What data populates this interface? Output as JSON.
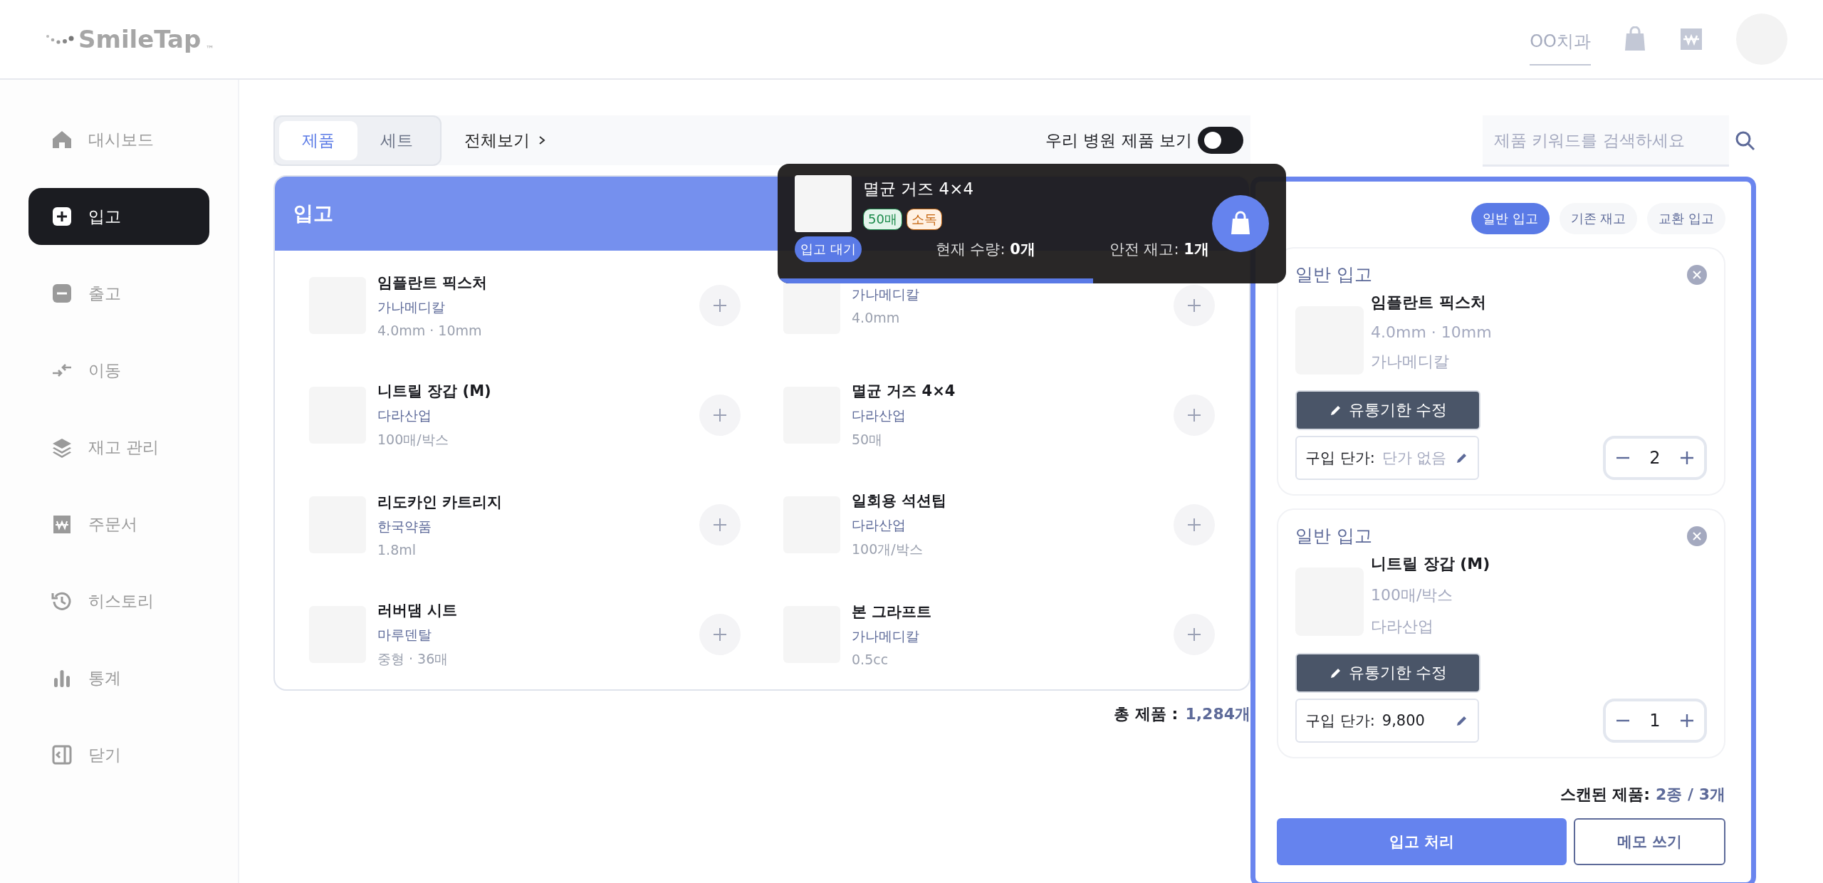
{
  "header": {
    "logo": "SmileTap",
    "trademark": "™",
    "clinic": "OO치과"
  },
  "sidebar": {
    "items": [
      {
        "label": "대시보드",
        "kind": "home",
        "selected": false
      },
      {
        "label": "입고",
        "kind": "plus",
        "selected": true
      },
      {
        "label": "출고",
        "kind": "minus",
        "selected": false
      },
      {
        "label": "이동",
        "kind": "move",
        "selected": false
      },
      {
        "label": "재고 관리",
        "kind": "layers",
        "selected": false
      },
      {
        "label": "주문서",
        "kind": "order",
        "selected": false
      },
      {
        "label": "히스토리",
        "kind": "history",
        "selected": false
      },
      {
        "label": "통계",
        "kind": "stats",
        "selected": false
      },
      {
        "label": "닫기",
        "kind": "collapse",
        "selected": false
      }
    ]
  },
  "toolbar": {
    "tabs": [
      {
        "label": "제품",
        "selected": true
      },
      {
        "label": "세트",
        "selected": false
      }
    ],
    "view_all": "전체보기",
    "toggle": {
      "label": "우리 병원 제품 보기",
      "on": false
    },
    "search": {
      "placeholder": "제품 키워드를 검색하세요"
    }
  },
  "receiving": {
    "title": "입고",
    "products": [
      {
        "name": "임플란트 픽스처",
        "maker": "가나메디칼",
        "spec": "4.0mm · 10mm"
      },
      {
        "maker": "가나메디칼",
        "spec": "4.0mm"
      },
      {
        "name": "니트릴 장갑 (M)",
        "maker": "다라산업",
        "spec": "100매/박스"
      },
      {
        "name": "멸균 거즈 4×4",
        "maker": "다라산업",
        "spec": "50매"
      },
      {
        "name": "리도카인 카트리지",
        "maker": "한국약품",
        "spec": "1.8ml"
      },
      {
        "name": "일회용 석션팁",
        "maker": "다라산업",
        "spec": "100개/박스"
      },
      {
        "name": "러버댐 시트",
        "maker": "마루덴탈",
        "spec": "중형 · 36매"
      },
      {
        "name": "본 그라프트",
        "maker": "가나메디칼",
        "spec": "0.5cc"
      }
    ],
    "total_label": "총 제품 :",
    "total_value": "1,284개"
  },
  "scan_popup": {
    "name": "멸균 거즈 4×4",
    "tags": [
      {
        "label": "50매",
        "color": "#1a8a4a"
      },
      {
        "label": "소독",
        "color": "#c4620a"
      }
    ],
    "status": "입고 대기",
    "current_label": "현재 수량:",
    "current_value": "0개",
    "safety_label": "안전 재고:",
    "safety_value": "1개",
    "level": 0.62
  },
  "cart": {
    "modes": [
      {
        "label": "일반 입고",
        "selected": true
      },
      {
        "label": "기존 재고",
        "selected": false
      },
      {
        "label": "교환 입고",
        "selected": false
      }
    ],
    "items": [
      {
        "type": "일반 입고",
        "name": "임플란트 픽스처",
        "spec": "4.0mm · 10mm",
        "maker": "가나메디칼",
        "expiry_button": "유통기한 수정",
        "price_label": "구입 단가:",
        "price": "단가 없음",
        "price_set": false,
        "qty": "2"
      },
      {
        "type": "일반 입고",
        "name": "니트릴 장갑 (M)",
        "spec": "100매/박스",
        "maker": "다라산업",
        "expiry_button": "유통기한 수정",
        "price_label": "구입 단가:",
        "price": "9,800",
        "price_set": true,
        "qty": "1"
      }
    ],
    "summary_label": "스캔된 제품:",
    "summary_value": "2종 / 3개",
    "submit": "입고 처리",
    "memo": "메모 쓰기"
  }
}
